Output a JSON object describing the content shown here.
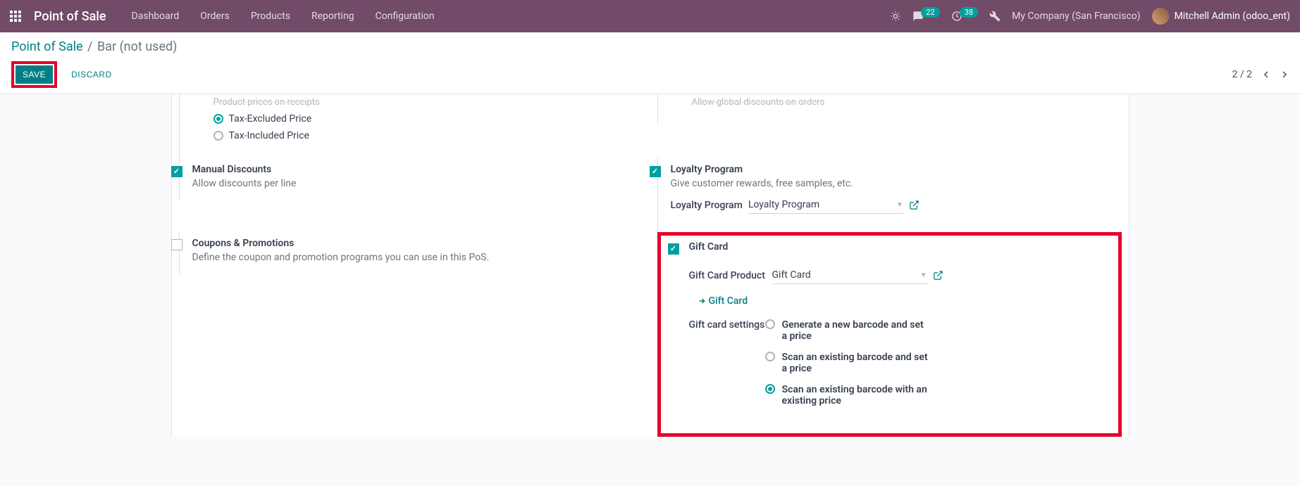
{
  "navbar": {
    "app_title": "Point of Sale",
    "menu": [
      "Dashboard",
      "Orders",
      "Products",
      "Reporting",
      "Configuration"
    ],
    "messages_badge": "22",
    "activities_badge": "38",
    "company": "My Company (San Francisco)",
    "user": "Mitchell Admin (odoo_ent)"
  },
  "breadcrumb": {
    "root": "Point of Sale",
    "current": "Bar (not used)"
  },
  "actions": {
    "save": "SAVE",
    "discard": "DISCARD"
  },
  "pager": {
    "text": "2 / 2"
  },
  "settings": {
    "cutoff_left": "Product prices on receipts",
    "cutoff_right": "Allow global discounts on orders",
    "tax_excluded": "Tax-Excluded Price",
    "tax_included": "Tax-Included Price",
    "manual_discounts": {
      "title": "Manual Discounts",
      "desc": "Allow discounts per line"
    },
    "loyalty": {
      "title": "Loyalty Program",
      "desc": "Give customer rewards, free samples, etc.",
      "field_label": "Loyalty Program",
      "field_value": "Loyalty Program"
    },
    "coupons": {
      "title": "Coupons & Promotions",
      "desc": "Define the coupon and promotion programs you can use in this PoS."
    },
    "gift_card": {
      "title": "Gift Card",
      "product_label": "Gift Card Product",
      "product_value": "Gift Card",
      "link": "Gift Card",
      "settings_label": "Gift card settings",
      "opt1": "Generate a new barcode and set a price",
      "opt2": "Scan an existing barcode and set a price",
      "opt3": "Scan an existing barcode with an existing price"
    }
  }
}
